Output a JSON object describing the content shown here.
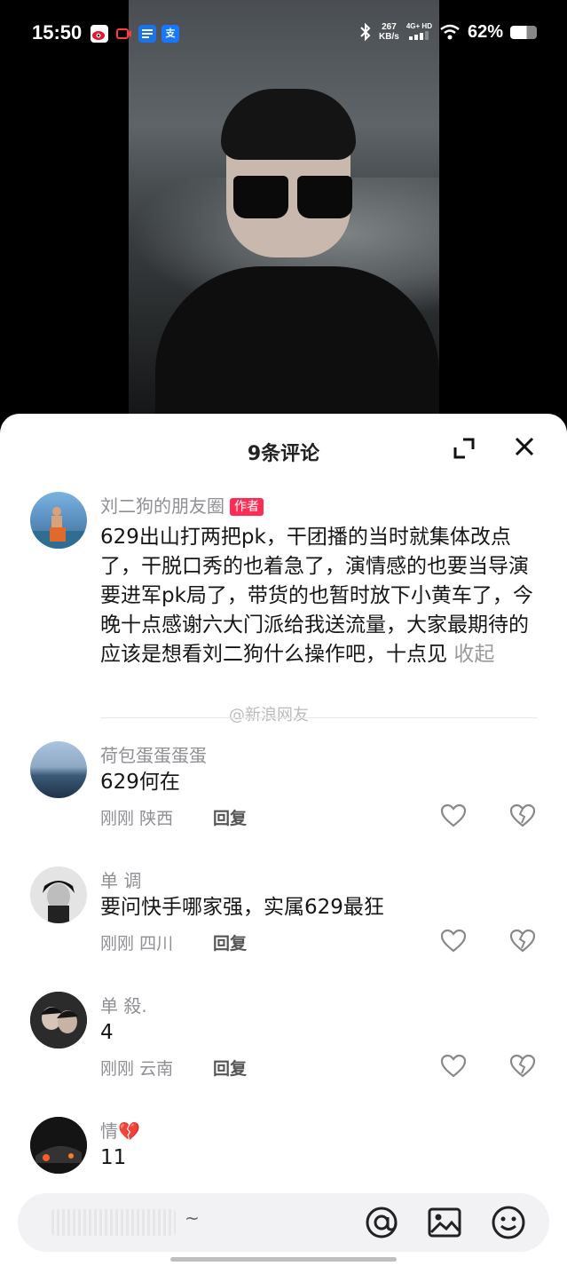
{
  "status_bar": {
    "time": "15:50",
    "app_icons": [
      "weibo-icon",
      "camera-record-icon",
      "news-icon",
      "alipay-icon"
    ],
    "alipay_glyph": "支",
    "net_speed_value": "267",
    "net_speed_unit": "KB/s",
    "network": "4G+ HD",
    "battery": "62%",
    "battery_level": 0.62
  },
  "sheet": {
    "title": "9条评论"
  },
  "comments": [
    {
      "name": "刘二狗的朋友圈",
      "badge": "作者",
      "text": "629出山打两把pk，干团播的当时就集体改点了，干脱口秀的也着急了，演情感的也要当导演要进军pk局了，带货的也暂时放下小黄车了，今晚十点感谢六大门派给我送流量，大家最期待的应该是想看刘二狗什么操作吧，十点见",
      "collapse": "收起",
      "watermark": "@新浪网友"
    },
    {
      "name": "荷包蛋蛋蛋蛋",
      "text": "629何在",
      "time": "刚刚",
      "location": "陕西",
      "reply": "回复"
    },
    {
      "name": "单 调",
      "text": "要问快手哪家强，实属629最狂",
      "time": "刚刚",
      "location": "四川",
      "reply": "回复"
    },
    {
      "name": "单 殺.",
      "text": "4",
      "time": "刚刚",
      "location": "云南",
      "reply": "回复"
    },
    {
      "name": "情💔",
      "text": "11"
    }
  ],
  "input_bar": {
    "placeholder": "~"
  },
  "colors": {
    "accent": "#fe2c55",
    "sheet_bg": "#ffffff",
    "muted_text": "#8f8f94"
  }
}
